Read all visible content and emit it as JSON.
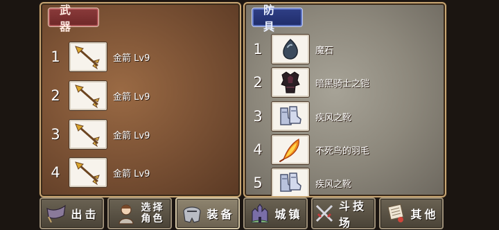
{
  "weapons_panel": {
    "title": "武器",
    "items": [
      {
        "index": "1",
        "name": "金箭 Lv9",
        "icon": "golden-arrow-icon"
      },
      {
        "index": "2",
        "name": "金箭 Lv9",
        "icon": "golden-arrow-icon"
      },
      {
        "index": "3",
        "name": "金箭 Lv9",
        "icon": "golden-arrow-icon"
      },
      {
        "index": "4",
        "name": "金箭 Lv9",
        "icon": "golden-arrow-icon"
      }
    ]
  },
  "armor_panel": {
    "title": "防具",
    "items": [
      {
        "index": "1",
        "name": "魔石",
        "icon": "magic-stone-icon"
      },
      {
        "index": "2",
        "name": "暗黑骑士之铠",
        "icon": "dark-knight-armor-icon"
      },
      {
        "index": "3",
        "name": "疾风之靴",
        "icon": "gale-boots-icon"
      },
      {
        "index": "4",
        "name": "不死鸟的羽毛",
        "icon": "phoenix-feather-icon"
      },
      {
        "index": "5",
        "name": "疾风之靴",
        "icon": "gale-boots-icon"
      }
    ]
  },
  "nav": {
    "sortie": "出击",
    "select_line1": "选择",
    "select_line2": "角色",
    "equipment": "装备",
    "town": "城镇",
    "arena": "斗技场",
    "other": "其他"
  },
  "active_tab": "equipment"
}
